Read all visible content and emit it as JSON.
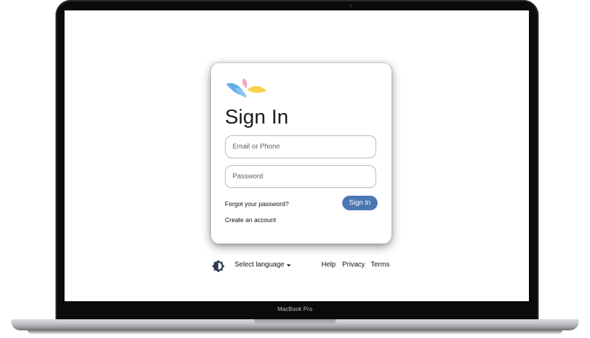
{
  "device": {
    "model_label": "MacBook Pro"
  },
  "login": {
    "title": "Sign In",
    "email_placeholder": "Email or Phone",
    "password_placeholder": "Password",
    "forgot_link": "Forgot your password?",
    "create_link": "Create an account",
    "signin_button": "Sign In"
  },
  "footer": {
    "theme_icon": "brightness-icon",
    "language_selector": "Select language",
    "links": [
      "Help",
      "Privacy",
      "Terms"
    ]
  },
  "colors": {
    "accent": "#4a77b4",
    "logo_blue": "#5aa9e6",
    "logo_pink": "#f4a7c0",
    "logo_yellow": "#f7d24a"
  }
}
